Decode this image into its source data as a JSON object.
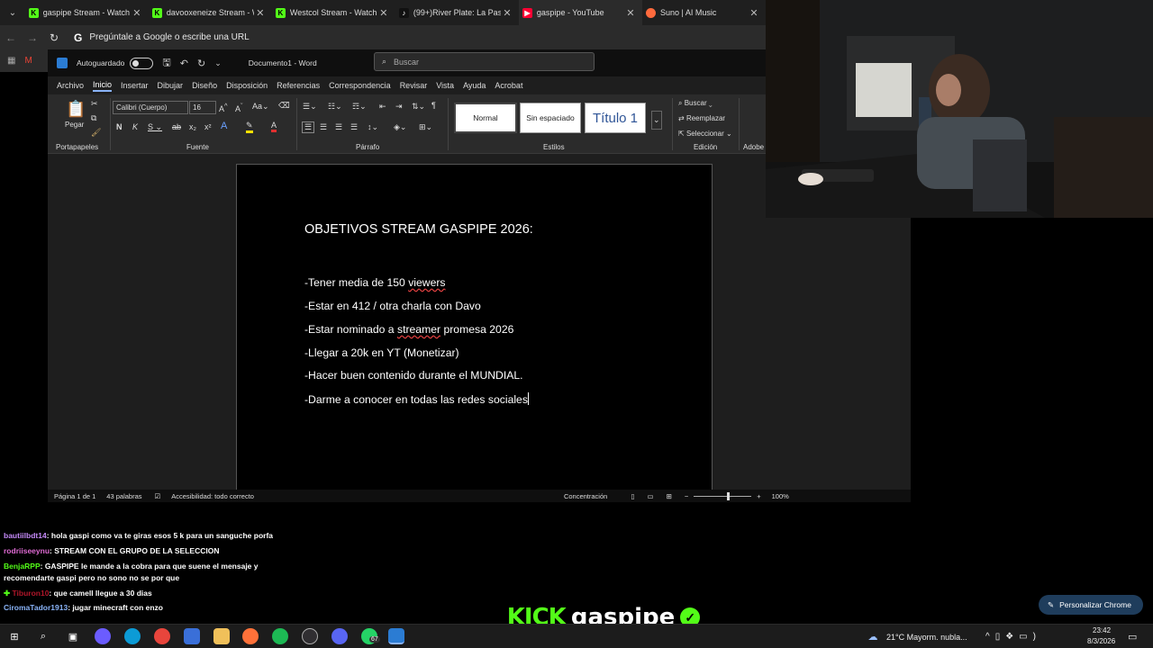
{
  "browser": {
    "tabs": [
      {
        "title": "gaspipe Stream - Watch L",
        "favicon": "K",
        "color": "#53fc18"
      },
      {
        "title": "davooxeneize Stream - W",
        "favicon": "K",
        "color": "#53fc18"
      },
      {
        "title": "Westcol Stream - Watch L",
        "favicon": "K",
        "color": "#53fc18"
      },
      {
        "title": "(99+)River Plate: La Pasió",
        "favicon": "♪",
        "color": "#111111"
      },
      {
        "title": "gaspipe - YouTube",
        "favicon": "▶",
        "color": "#ff0033"
      },
      {
        "title": "Suno | AI Music",
        "favicon": "●",
        "color": "#ff6a3d"
      }
    ],
    "url_placeholder": "Pregúntale a Google o escribe una URL",
    "google_g": "G"
  },
  "word": {
    "autosave_label": "Autoguardado",
    "doc_title": "Documento1  -  Word",
    "search_placeholder": "Buscar",
    "menu": [
      "Archivo",
      "Inicio",
      "Insertar",
      "Dibujar",
      "Diseño",
      "Disposición",
      "Referencias",
      "Correspondencia",
      "Revisar",
      "Vista",
      "Ayuda",
      "Acrobat"
    ],
    "active_menu": "Inicio",
    "ribbon": {
      "paste_label": "Pegar",
      "clipboard_label": "Portapapeles",
      "font_name": "Calibri (Cuerpo)",
      "font_size": "16",
      "font_group": "Fuente",
      "paragraph_group": "Párrafo",
      "styles_group": "Estilos",
      "edit_group": "Edición",
      "adobe_group": "Adobe",
      "styles": [
        "Normal",
        "Sin espaciado",
        "Título 1"
      ],
      "edit_buttons": [
        "Buscar",
        "Reemplazar",
        "Seleccionar"
      ]
    },
    "document": {
      "heading": "OBJETIVOS STREAM GASPIPE 2026:",
      "line1_a": "-Tener media de 150 ",
      "line1_b": "viewers",
      "line2": "-Estar en 412 / otra charla con Davo",
      "line3_a": "-Estar nominado a ",
      "line3_b": "streamer",
      "line3_c": " promesa 2026",
      "line4": "-Llegar a 20k en YT (Monetizar)",
      "line5": "-Hacer buen contenido durante el MUNDIAL.",
      "line6": "-Darme a conocer en todas las redes sociales"
    },
    "status": {
      "page": "Página 1 de 1",
      "words": "43 palabras",
      "accessibility": "Accesibilidad: todo correcto",
      "focus": "Concentración",
      "zoom": "100%"
    }
  },
  "chat": [
    {
      "user": "bautiilbdt14",
      "color": "#c58af9",
      "text": ": hola gaspi como va te giras esos 5 k para un sanguche porfa"
    },
    {
      "user": "rodriiseeynu",
      "color": "#e06bd4",
      "text": ": STREAM CON EL GRUPO DE LA SELECCION"
    },
    {
      "user": "BenjaRPP",
      "color": "#53fc18",
      "text": ": GASPIPE le mande a la cobra para que suene el mensaje y"
    },
    {
      "user": "",
      "color": "#ffffff",
      "text": "recomendarte gaspi pero no sono no se por que"
    },
    {
      "user": "Tiburon10",
      "color": "#b0162a",
      "text": ": que camell llegue a 30 dias"
    },
    {
      "user": "CiromaTador1913",
      "color": "#8ab4f8",
      "text": ": jugar minecraft con enzo"
    }
  ],
  "kick": {
    "logo": "KICK",
    "channel": "gaspipe"
  },
  "chrome_custom": "Personalizar Chrome",
  "taskbar": {
    "weather": "21°C   Mayorm. nubla...",
    "time": "23:42",
    "date": "8/3/2026",
    "badge": "67"
  }
}
